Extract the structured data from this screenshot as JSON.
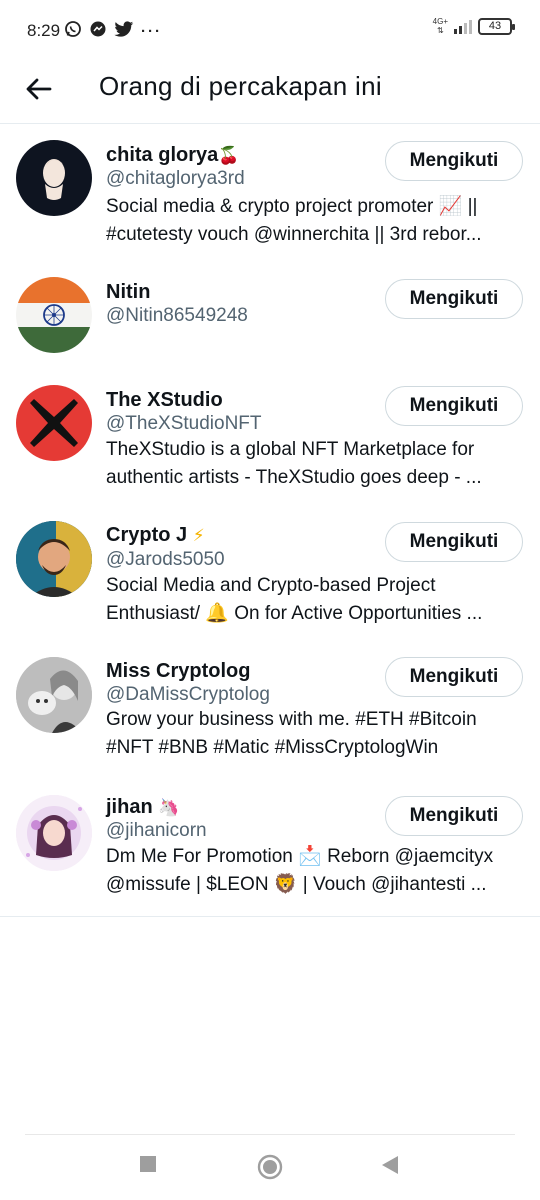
{
  "status_bar": {
    "time": "8:29",
    "network": "4G+",
    "battery": "43"
  },
  "header": {
    "title": "Orang di percakapan ini"
  },
  "users": [
    {
      "name": "chita glorya",
      "name_emoji": "🍒",
      "handle": "@chitaglorya3rd",
      "bio": [
        "Social media & crypto project promoter 📈 ||",
        "#cutetesty vouch @winnerchita || 3rd rebor..."
      ],
      "button": "Mengikuti"
    },
    {
      "name": "Nitin",
      "name_emoji": "",
      "handle": "@Nitin86549248",
      "bio": [],
      "button": "Mengikuti"
    },
    {
      "name": "The XStudio",
      "name_emoji": "",
      "handle": "@TheXStudioNFT",
      "bio": [
        "TheXStudio is a global NFT Marketplace for",
        "authentic artists - TheXStudio goes deep  - ..."
      ],
      "button": "Mengikuti"
    },
    {
      "name": "Crypto J",
      "name_emoji": "⚡",
      "handle": "@Jarods5050",
      "bio": [
        "Social Media and Crypto-based Project",
        "Enthusiast/ 🔔 On for Active Opportunities ..."
      ],
      "button": "Mengikuti"
    },
    {
      "name": "Miss Cryptolog",
      "name_emoji": "",
      "handle": "@DaMissCryptolog",
      "bio": [
        "Grow your business with me. #ETH #Bitcoin",
        "#NFT #BNB #Matic #MissCryptologWin"
      ],
      "button": "Mengikuti"
    },
    {
      "name": "jihan",
      "name_emoji": "🦄",
      "handle": "@jihanicorn",
      "bio": [
        "Dm Me For Promotion 📩 Reborn @jaemcityx",
        "@missufe | $LEON 🦁 | Vouch @jihantesti ..."
      ],
      "button": "Mengikuti"
    }
  ]
}
